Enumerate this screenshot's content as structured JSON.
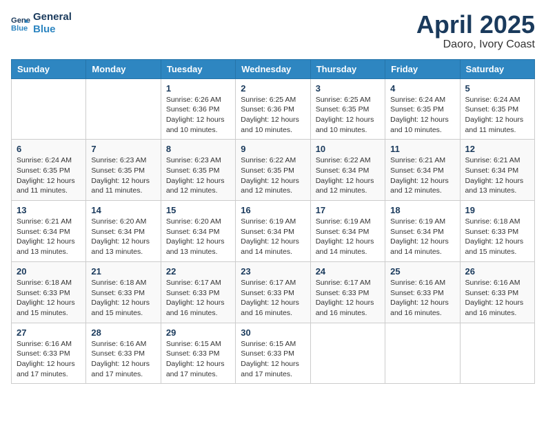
{
  "logo": {
    "line1": "General",
    "line2": "Blue"
  },
  "title": "April 2025",
  "subtitle": "Daoro, Ivory Coast",
  "days_of_week": [
    "Sunday",
    "Monday",
    "Tuesday",
    "Wednesday",
    "Thursday",
    "Friday",
    "Saturday"
  ],
  "weeks": [
    [
      {
        "day": "",
        "info": ""
      },
      {
        "day": "",
        "info": ""
      },
      {
        "day": "1",
        "info": "Sunrise: 6:26 AM\nSunset: 6:36 PM\nDaylight: 12 hours and 10 minutes."
      },
      {
        "day": "2",
        "info": "Sunrise: 6:25 AM\nSunset: 6:36 PM\nDaylight: 12 hours and 10 minutes."
      },
      {
        "day": "3",
        "info": "Sunrise: 6:25 AM\nSunset: 6:35 PM\nDaylight: 12 hours and 10 minutes."
      },
      {
        "day": "4",
        "info": "Sunrise: 6:24 AM\nSunset: 6:35 PM\nDaylight: 12 hours and 10 minutes."
      },
      {
        "day": "5",
        "info": "Sunrise: 6:24 AM\nSunset: 6:35 PM\nDaylight: 12 hours and 11 minutes."
      }
    ],
    [
      {
        "day": "6",
        "info": "Sunrise: 6:24 AM\nSunset: 6:35 PM\nDaylight: 12 hours and 11 minutes."
      },
      {
        "day": "7",
        "info": "Sunrise: 6:23 AM\nSunset: 6:35 PM\nDaylight: 12 hours and 11 minutes."
      },
      {
        "day": "8",
        "info": "Sunrise: 6:23 AM\nSunset: 6:35 PM\nDaylight: 12 hours and 12 minutes."
      },
      {
        "day": "9",
        "info": "Sunrise: 6:22 AM\nSunset: 6:35 PM\nDaylight: 12 hours and 12 minutes."
      },
      {
        "day": "10",
        "info": "Sunrise: 6:22 AM\nSunset: 6:34 PM\nDaylight: 12 hours and 12 minutes."
      },
      {
        "day": "11",
        "info": "Sunrise: 6:21 AM\nSunset: 6:34 PM\nDaylight: 12 hours and 12 minutes."
      },
      {
        "day": "12",
        "info": "Sunrise: 6:21 AM\nSunset: 6:34 PM\nDaylight: 12 hours and 13 minutes."
      }
    ],
    [
      {
        "day": "13",
        "info": "Sunrise: 6:21 AM\nSunset: 6:34 PM\nDaylight: 12 hours and 13 minutes."
      },
      {
        "day": "14",
        "info": "Sunrise: 6:20 AM\nSunset: 6:34 PM\nDaylight: 12 hours and 13 minutes."
      },
      {
        "day": "15",
        "info": "Sunrise: 6:20 AM\nSunset: 6:34 PM\nDaylight: 12 hours and 13 minutes."
      },
      {
        "day": "16",
        "info": "Sunrise: 6:19 AM\nSunset: 6:34 PM\nDaylight: 12 hours and 14 minutes."
      },
      {
        "day": "17",
        "info": "Sunrise: 6:19 AM\nSunset: 6:34 PM\nDaylight: 12 hours and 14 minutes."
      },
      {
        "day": "18",
        "info": "Sunrise: 6:19 AM\nSunset: 6:34 PM\nDaylight: 12 hours and 14 minutes."
      },
      {
        "day": "19",
        "info": "Sunrise: 6:18 AM\nSunset: 6:33 PM\nDaylight: 12 hours and 15 minutes."
      }
    ],
    [
      {
        "day": "20",
        "info": "Sunrise: 6:18 AM\nSunset: 6:33 PM\nDaylight: 12 hours and 15 minutes."
      },
      {
        "day": "21",
        "info": "Sunrise: 6:18 AM\nSunset: 6:33 PM\nDaylight: 12 hours and 15 minutes."
      },
      {
        "day": "22",
        "info": "Sunrise: 6:17 AM\nSunset: 6:33 PM\nDaylight: 12 hours and 16 minutes."
      },
      {
        "day": "23",
        "info": "Sunrise: 6:17 AM\nSunset: 6:33 PM\nDaylight: 12 hours and 16 minutes."
      },
      {
        "day": "24",
        "info": "Sunrise: 6:17 AM\nSunset: 6:33 PM\nDaylight: 12 hours and 16 minutes."
      },
      {
        "day": "25",
        "info": "Sunrise: 6:16 AM\nSunset: 6:33 PM\nDaylight: 12 hours and 16 minutes."
      },
      {
        "day": "26",
        "info": "Sunrise: 6:16 AM\nSunset: 6:33 PM\nDaylight: 12 hours and 16 minutes."
      }
    ],
    [
      {
        "day": "27",
        "info": "Sunrise: 6:16 AM\nSunset: 6:33 PM\nDaylight: 12 hours and 17 minutes."
      },
      {
        "day": "28",
        "info": "Sunrise: 6:16 AM\nSunset: 6:33 PM\nDaylight: 12 hours and 17 minutes."
      },
      {
        "day": "29",
        "info": "Sunrise: 6:15 AM\nSunset: 6:33 PM\nDaylight: 12 hours and 17 minutes."
      },
      {
        "day": "30",
        "info": "Sunrise: 6:15 AM\nSunset: 6:33 PM\nDaylight: 12 hours and 17 minutes."
      },
      {
        "day": "",
        "info": ""
      },
      {
        "day": "",
        "info": ""
      },
      {
        "day": "",
        "info": ""
      }
    ]
  ]
}
